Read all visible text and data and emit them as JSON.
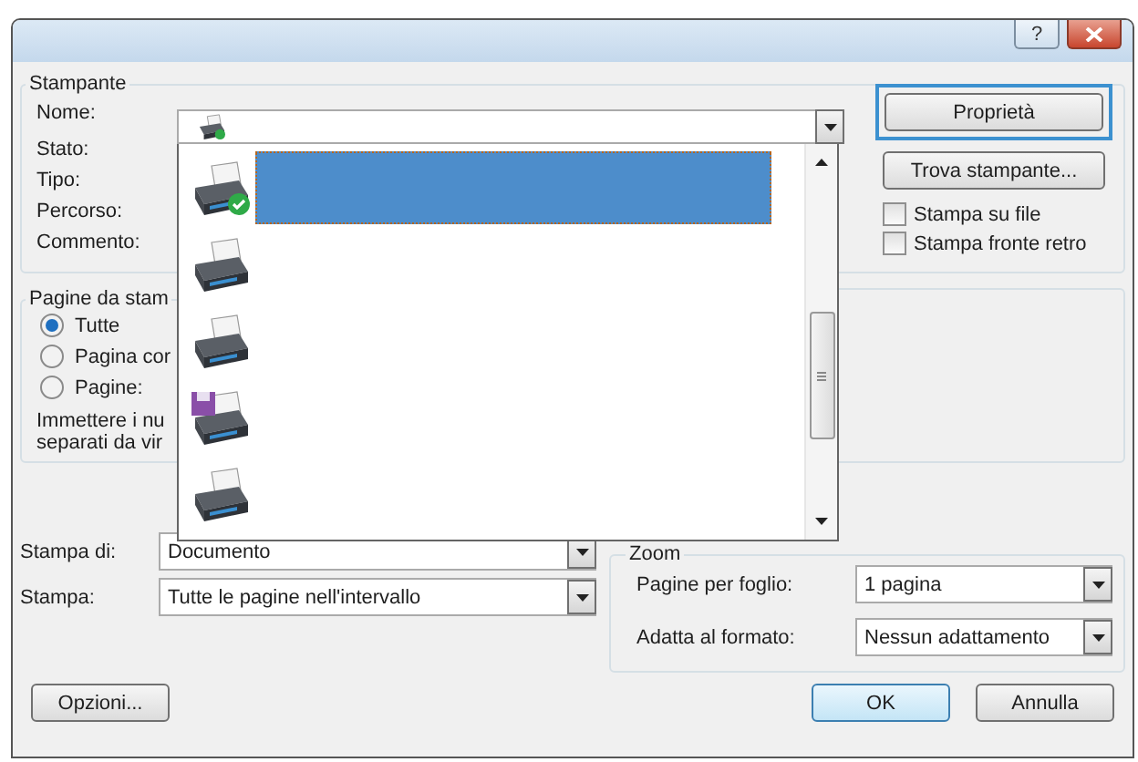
{
  "window": {
    "help_button": "?"
  },
  "printer": {
    "legend": "Stampante",
    "fields": [
      {
        "label": "Nome:"
      },
      {
        "label": "Stato:"
      },
      {
        "label": "Tipo:"
      },
      {
        "label": "Percorso:"
      },
      {
        "label": "Commento:"
      }
    ],
    "properties_button": "Proprietà",
    "find_button": "Trova stampante...",
    "checkboxes": [
      {
        "label": "Stampa su file",
        "checked": false
      },
      {
        "label": "Stampa fronte retro",
        "checked": false
      }
    ]
  },
  "printer_dropdown": {
    "items": [
      {
        "kind": "default",
        "selected": true
      },
      {
        "kind": "printer",
        "selected": false
      },
      {
        "kind": "printer",
        "selected": false
      },
      {
        "kind": "file",
        "selected": false
      },
      {
        "kind": "printer",
        "selected": false
      }
    ]
  },
  "pages": {
    "legend": "Pagine da stam",
    "options": [
      {
        "label": "Tutte",
        "selected": true
      },
      {
        "label": "Pagina cor",
        "selected": false
      },
      {
        "label": "Pagine:",
        "selected": false
      }
    ],
    "hint_lines": [
      "Immettere i nu",
      "separati da vir"
    ]
  },
  "print_what": [
    {
      "label": "Stampa di:",
      "value": "Documento"
    },
    {
      "label": "Stampa:",
      "value": "Tutte le pagine nell'intervallo"
    }
  ],
  "zoom": {
    "legend": "Zoom",
    "fields": [
      {
        "label": "Pagine per foglio:",
        "value": "1 pagina"
      },
      {
        "label": "Adatta al formato:",
        "value": "Nessun adattamento"
      }
    ]
  },
  "buttons": {
    "options": "Opzioni...",
    "ok": "OK",
    "cancel": "Annulla"
  }
}
